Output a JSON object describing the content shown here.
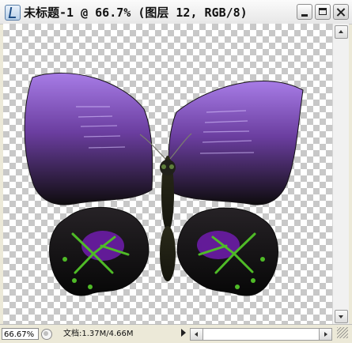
{
  "window": {
    "title": "未标题-1 @ 66.7% (图层 12, RGB/8)",
    "controls": {
      "minimize": "minimize",
      "maximize": "maximize",
      "close": "close"
    }
  },
  "canvas": {
    "background": "transparency-checkerboard",
    "content": "butterfly-illustration",
    "colors": {
      "wing_purple": "#a77ce6",
      "wing_dark": "#111111",
      "accent_green": "#4fbb27",
      "body_dark": "#1f1e11"
    }
  },
  "status": {
    "zoom": "66.67%",
    "doc_info": "文档:1.37M/4.66M"
  },
  "icons": [
    "app-icon",
    "minimize-icon",
    "maximize-icon",
    "close-icon",
    "scroll-up-icon",
    "scroll-down-icon",
    "scroll-left-icon",
    "scroll-right-icon",
    "status-menu-icon",
    "resize-grip-icon"
  ]
}
